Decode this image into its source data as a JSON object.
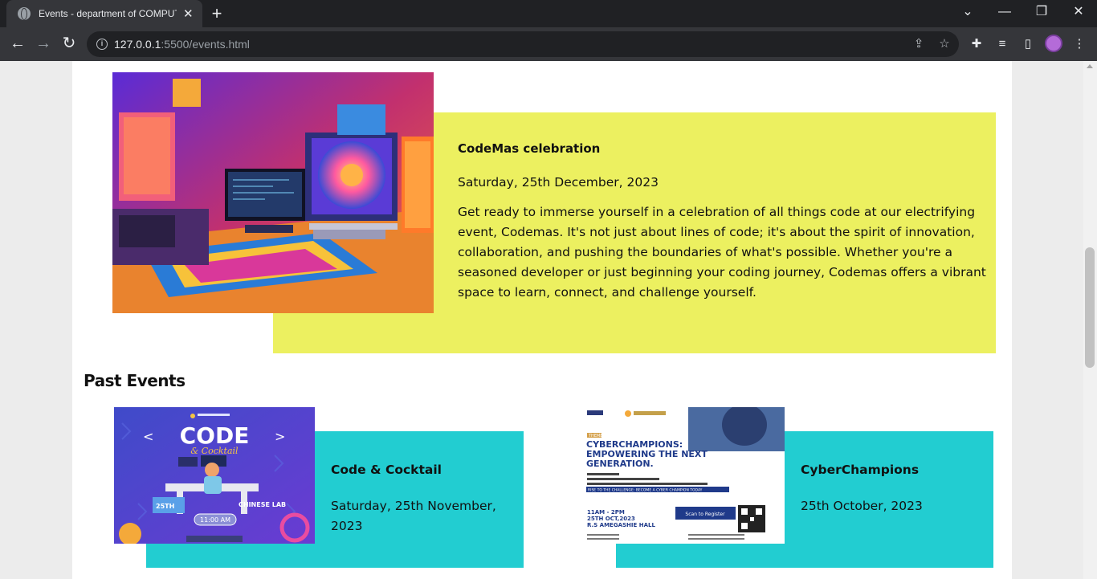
{
  "browser": {
    "tab_title": "Events - department of COMPUT",
    "url_host": "127.0.0.1",
    "url_rest": ":5500/events.html",
    "new_tab": "+",
    "tab_close": "✕"
  },
  "featured_event": {
    "title": "CodeMas celebration",
    "date": "Saturday, 25th December, 2023",
    "description": "Get ready to immerse yourself in a celebration of all things code at our electrifying event, Codemas. It's not just about lines of code; it's about the spirit of innovation, collaboration, and pushing the boundaries of what's possible. Whether you're a seasoned developer or just beginning your coding journey, Codemas offers a vibrant space to learn, connect, and challenge yourself.",
    "box_color": "#ecf060"
  },
  "past_events": {
    "heading": "Past Events",
    "card_color": "#22cdd1",
    "items": [
      {
        "title": "Code & Cocktail",
        "date": "Saturday, 25th November, 2023",
        "poster": {
          "big_title": "CODE",
          "subtitle": "& Cocktail",
          "date_text": "25TH",
          "venue": "CHINESE LAB",
          "time": "11:00 AM"
        }
      },
      {
        "title": "CyberChampions",
        "date": "25th October, 2023",
        "poster": {
          "theme": "THEME:",
          "headline": "CYBERCHAMPIONS: EMPOWERING THE NEXT GENERATION.",
          "cta": "RISE TO THE CHALLENGE: BECOME A CYBER CHAMPION TODAY",
          "time": "11AM - 2PM",
          "date_text": "25TH OCT,2023",
          "venue": "R.S AMEGASHIE HALL",
          "button": "Scan to Register"
        }
      }
    ]
  }
}
